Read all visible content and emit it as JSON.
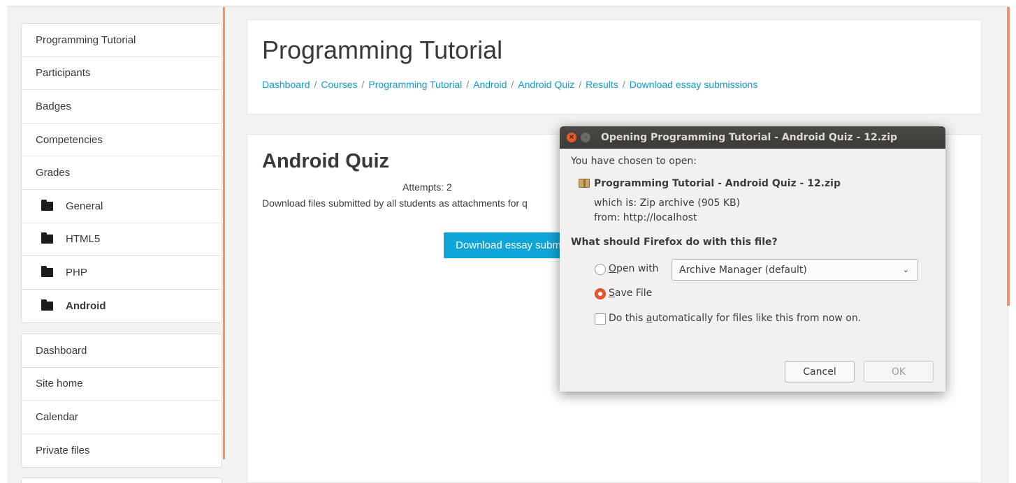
{
  "sidebar": {
    "course_nav": [
      {
        "label": "Programming Tutorial",
        "folder": false
      },
      {
        "label": "Participants",
        "folder": false
      },
      {
        "label": "Badges",
        "folder": false
      },
      {
        "label": "Competencies",
        "folder": false
      },
      {
        "label": "Grades",
        "folder": false
      },
      {
        "label": "General",
        "folder": true
      },
      {
        "label": "HTML5",
        "folder": true
      },
      {
        "label": "PHP",
        "folder": true
      },
      {
        "label": "Android",
        "folder": true,
        "active": true
      }
    ],
    "site_nav": [
      {
        "label": "Dashboard"
      },
      {
        "label": "Site home"
      },
      {
        "label": "Calendar"
      },
      {
        "label": "Private files"
      }
    ]
  },
  "header": {
    "title": "Programming Tutorial",
    "breadcrumb": [
      "Dashboard",
      "Courses",
      "Programming Tutorial",
      "Android",
      "Android Quiz",
      "Results",
      "Download essay submissions"
    ],
    "separator": "/"
  },
  "main": {
    "quiz_title": "Android Quiz",
    "attempts": "Attempts: 2",
    "instructions": "Download files submitted by all students as attachments for q",
    "download_button": "Download essay subm"
  },
  "dialog": {
    "title": "Opening Programming Tutorial - Android Quiz - 12.zip",
    "close_glyph": "×",
    "min_glyph": "–",
    "intro": "You have chosen to open:",
    "filename": "Programming Tutorial - Android Quiz - 12.zip",
    "which_is": "which is: Zip archive (905 KB)",
    "from": "from: http://localhost",
    "question": "What should Firefox do with this file?",
    "open_with_prefix": "",
    "open_with_mnemonic": "O",
    "open_with_rest": "pen with",
    "open_with_app": "Archive Manager (default)",
    "save_file_mnemonic": "S",
    "save_file_rest": "ave File",
    "save_file_selected": true,
    "auto_prefix": "Do this ",
    "auto_mnemonic": "a",
    "auto_rest": "utomatically for files like this from now on.",
    "auto_checked": false,
    "cancel_label": "Cancel",
    "ok_label": "OK"
  },
  "colors": {
    "link": "#0f9bd3",
    "primary_button": "#10a5d8",
    "accent": "#f0916a",
    "ubuntu_orange": "#e8582f"
  }
}
